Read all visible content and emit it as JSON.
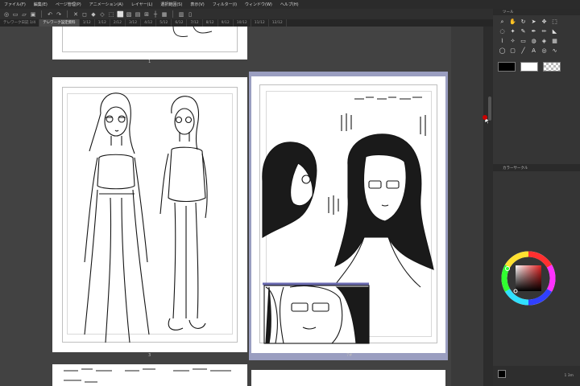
{
  "menubar": {
    "items": [
      "ファイル(F)",
      "編集(E)",
      "ページ管理(P)",
      "アニメーション(A)",
      "レイヤー(L)",
      "選択範囲(S)",
      "表示(V)",
      "フィルター(I)",
      "ウィンドウ(W)",
      "ヘルプ(H)"
    ]
  },
  "tabs": [
    "テレワーク日記 1/4",
    "テレワーク設定資料",
    "1/12",
    "1/12",
    "2/12",
    "3/12",
    "4/12",
    "5/12",
    "6/12",
    "7/12",
    "8/12",
    "9/12",
    "10/12",
    "11/12",
    "12/12"
  ],
  "pages": {
    "top_page_number": "1",
    "left_page_number": "3",
    "right_page_number": "7#"
  },
  "right_panel": {
    "tool_header": "ツール",
    "color_header": "カラーサークル",
    "bottom_readout": "1   3m"
  },
  "colors": {
    "main_color": "#000000",
    "sub_color": "#ffffff",
    "selection_highlight": "#9a9ec0"
  }
}
